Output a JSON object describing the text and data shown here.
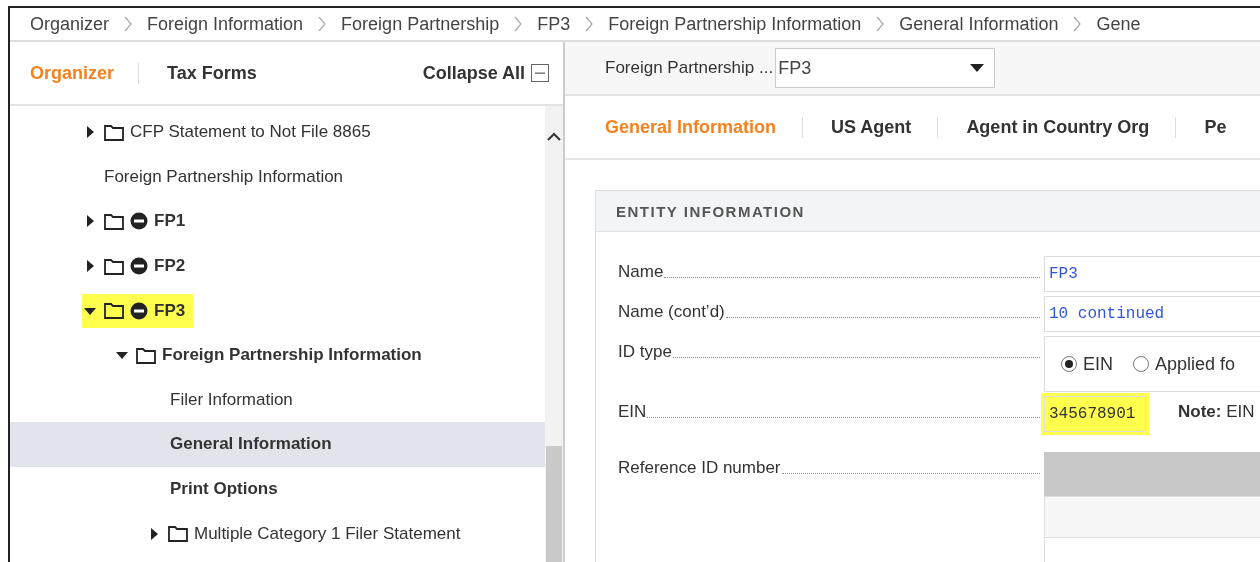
{
  "breadcrumbs": [
    "Organizer",
    "Foreign Information",
    "Foreign Partnership",
    "FP3",
    "Foreign Partnership Information",
    "General Information",
    "Gene"
  ],
  "sidebar": {
    "tabs": [
      {
        "label": "Organizer",
        "selected": true
      },
      {
        "label": "Tax Forms",
        "selected": false
      }
    ],
    "collapse_all": "Collapse All",
    "tree": [
      {
        "kind": "folder",
        "label": "CFP Statement to Not File 8865",
        "blocked": false,
        "expanded": false,
        "bold": false,
        "selected": false,
        "highlighted": false
      },
      {
        "kind": "heading",
        "label": "Foreign Partnership Information",
        "bold": false,
        "selected": false,
        "highlighted": false
      },
      {
        "kind": "folder",
        "label": "FP1",
        "blocked": true,
        "expanded": false,
        "bold": true,
        "selected": false,
        "highlighted": false
      },
      {
        "kind": "folder",
        "label": "FP2",
        "blocked": true,
        "expanded": false,
        "bold": true,
        "selected": false,
        "highlighted": false
      },
      {
        "kind": "folder",
        "label": "FP3",
        "blocked": true,
        "expanded": true,
        "bold": true,
        "selected": false,
        "highlighted": true,
        "children": [
          {
            "kind": "folder",
            "label": "Foreign Partnership Information",
            "blocked": false,
            "expanded": true,
            "bold": true,
            "selected": false,
            "highlighted": false,
            "children": [
              {
                "kind": "leaf",
                "label": "Filer Information",
                "bold": false,
                "selected": false,
                "highlighted": false
              },
              {
                "kind": "leaf",
                "label": "General Information",
                "bold": true,
                "selected": true,
                "highlighted": false
              },
              {
                "kind": "leaf",
                "label": "Print Options",
                "bold": true,
                "selected": false,
                "highlighted": false
              },
              {
                "kind": "folder",
                "label": "Multiple Category 1 Filer Statement",
                "blocked": false,
                "expanded": false,
                "bold": false,
                "selected": false,
                "highlighted": false
              }
            ]
          }
        ]
      }
    ]
  },
  "entity_selector": {
    "label": "Foreign Partnership ...",
    "value": "FP3"
  },
  "tabs": [
    {
      "label": "General Information",
      "selected": true
    },
    {
      "label": "US Agent",
      "selected": false
    },
    {
      "label": "Agent in Country Org",
      "selected": false
    },
    {
      "label": "Pe",
      "selected": false
    }
  ],
  "section": {
    "title": "ENTITY INFORMATION",
    "fields": [
      {
        "kind": "text",
        "label": "Name",
        "value": "FP3",
        "highlighted": false
      },
      {
        "kind": "text",
        "label": "Name (cont’d)",
        "value": "10 continued",
        "highlighted": false
      },
      {
        "kind": "radio",
        "label": "ID type",
        "options": [
          {
            "label": "EIN",
            "selected": true
          },
          {
            "label": "Applied fo",
            "selected": false
          }
        ]
      },
      {
        "kind": "text",
        "label": "EIN",
        "value": "345678901",
        "highlighted": true,
        "note": "**Note:** EIN"
      },
      {
        "kind": "disabled",
        "label": "Reference ID number"
      }
    ]
  }
}
